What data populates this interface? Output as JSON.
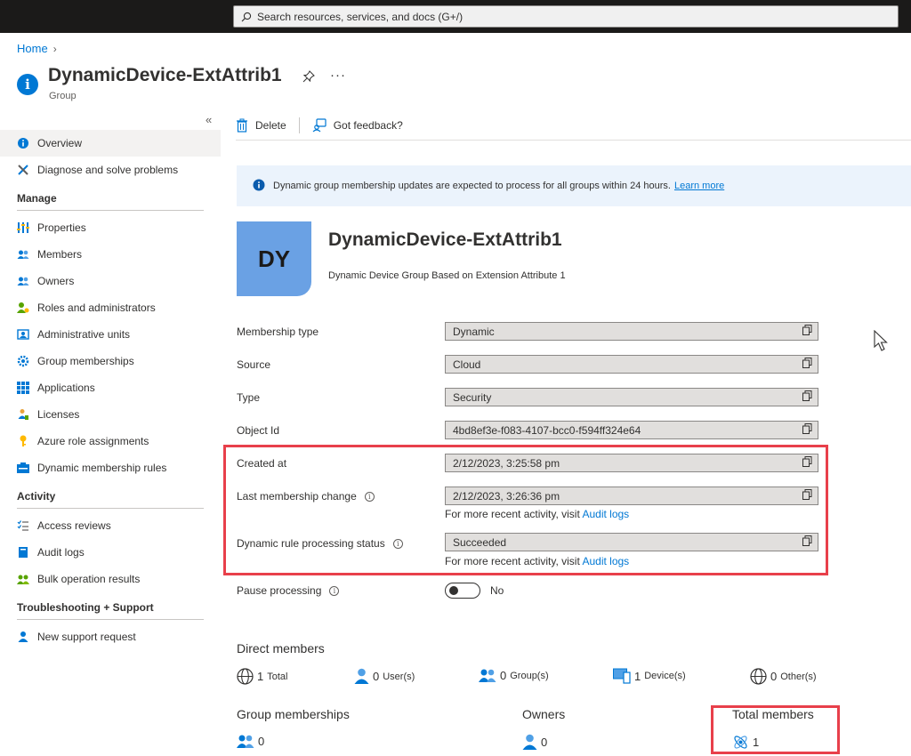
{
  "topbar": {
    "search_placeholder": "Search resources, services, and docs (G+/)"
  },
  "breadcrumb": {
    "home": "Home"
  },
  "header": {
    "title": "DynamicDevice-ExtAttrib1",
    "subtitle": "Group",
    "more": "···"
  },
  "sidebar": {
    "collapse": "«",
    "top_items": [
      {
        "label": "Overview",
        "icon": "info-icon",
        "active": true
      },
      {
        "label": "Diagnose and solve problems",
        "icon": "wrench-icon"
      }
    ],
    "sections": [
      {
        "title": "Manage",
        "items": [
          {
            "label": "Properties",
            "icon": "properties-icon"
          },
          {
            "label": "Members",
            "icon": "members-icon"
          },
          {
            "label": "Owners",
            "icon": "owners-icon"
          },
          {
            "label": "Roles and administrators",
            "icon": "roles-icon"
          },
          {
            "label": "Administrative units",
            "icon": "admin-units-icon"
          },
          {
            "label": "Group memberships",
            "icon": "gear-icon"
          },
          {
            "label": "Applications",
            "icon": "apps-grid-icon"
          },
          {
            "label": "Licenses",
            "icon": "licenses-icon"
          },
          {
            "label": "Azure role assignments",
            "icon": "key-icon"
          },
          {
            "label": "Dynamic membership rules",
            "icon": "rules-icon"
          }
        ]
      },
      {
        "title": "Activity",
        "items": [
          {
            "label": "Access reviews",
            "icon": "checklist-icon"
          },
          {
            "label": "Audit logs",
            "icon": "book-icon"
          },
          {
            "label": "Bulk operation results",
            "icon": "bulk-icon"
          }
        ]
      },
      {
        "title": "Troubleshooting + Support",
        "items": [
          {
            "label": "New support request",
            "icon": "support-person-icon"
          }
        ]
      }
    ]
  },
  "commands": {
    "delete": "Delete",
    "feedback": "Got feedback?"
  },
  "banner": {
    "text": "Dynamic group membership updates are expected to process for all groups within 24 hours.",
    "link": "Learn more"
  },
  "group": {
    "initials": "DY",
    "name": "DynamicDevice-ExtAttrib1",
    "description": "Dynamic Device Group Based on Extension Attribute 1"
  },
  "properties": {
    "membership_type": {
      "label": "Membership type",
      "value": "Dynamic"
    },
    "source": {
      "label": "Source",
      "value": "Cloud"
    },
    "type": {
      "label": "Type",
      "value": "Security"
    },
    "object_id": {
      "label": "Object Id",
      "value": "4bd8ef3e-f083-4107-bcc0-f594ff324e64"
    },
    "created_at": {
      "label": "Created at",
      "value": "2/12/2023, 3:25:58 pm"
    },
    "last_change": {
      "label": "Last membership change",
      "value": "2/12/2023, 3:26:36 pm"
    },
    "rule_status": {
      "label": "Dynamic rule processing status",
      "value": "Succeeded"
    },
    "pause": {
      "label": "Pause processing",
      "value": "No"
    }
  },
  "notes": {
    "prefix": "For more recent activity, visit",
    "link": "Audit logs"
  },
  "direct_members": {
    "title": "Direct members",
    "total": {
      "count": "1",
      "label": "Total"
    },
    "users": {
      "count": "0",
      "label": "User(s)"
    },
    "groups": {
      "count": "0",
      "label": "Group(s)"
    },
    "devices": {
      "count": "1",
      "label": "Device(s)"
    },
    "others": {
      "count": "0",
      "label": "Other(s)"
    }
  },
  "summary": {
    "group_memberships": {
      "title": "Group memberships",
      "count": "0"
    },
    "owners": {
      "title": "Owners",
      "count": "0"
    },
    "total_members": {
      "title": "Total members",
      "count": "1"
    }
  },
  "colors": {
    "accent": "#0078d4",
    "highlight": "#e8404b",
    "avatar": "#6aa1e4"
  }
}
